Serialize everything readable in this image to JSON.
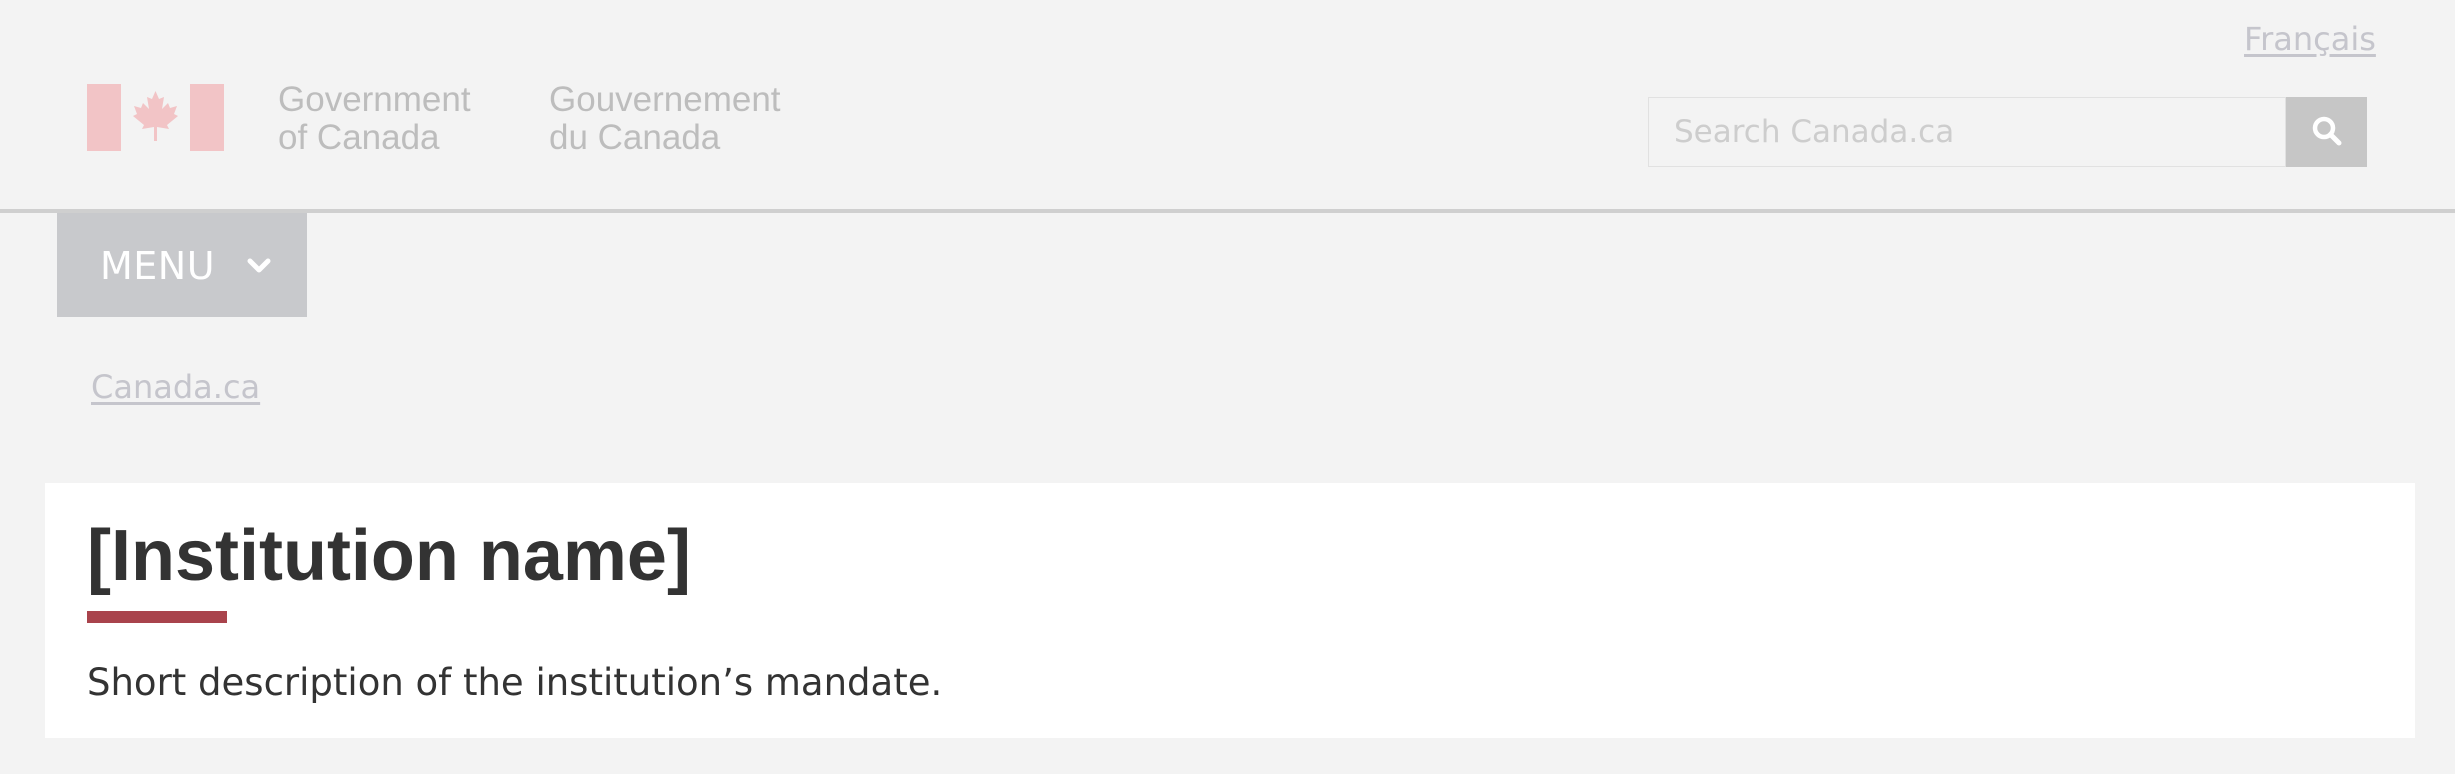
{
  "header": {
    "language_link": "Français",
    "signature_en": {
      "line1": "Government",
      "line2": "of Canada"
    },
    "signature_fr": {
      "line1": "Gouvernement",
      "line2": "du Canada"
    },
    "search": {
      "placeholder": "Search Canada.ca",
      "value": "",
      "button_icon": "search-icon"
    },
    "flag_icon": "canada-flag-icon"
  },
  "menu": {
    "label": "MENU",
    "icon": "chevron-down-icon"
  },
  "breadcrumb": {
    "items": [
      "Canada.ca"
    ]
  },
  "main": {
    "title": "[Institution name]",
    "description": "Short description of the institution’s mandate."
  },
  "colors": {
    "background": "#f3f3f3",
    "muted_text": "#bdbdbd",
    "link": "#c5c5cc",
    "menu_bg": "#c8c9cc",
    "search_button_bg": "#c6c6c6",
    "title_text": "#333333",
    "title_accent": "#a9434c",
    "flag_red": "#f2c4c6",
    "panel_bg": "#ffffff"
  }
}
